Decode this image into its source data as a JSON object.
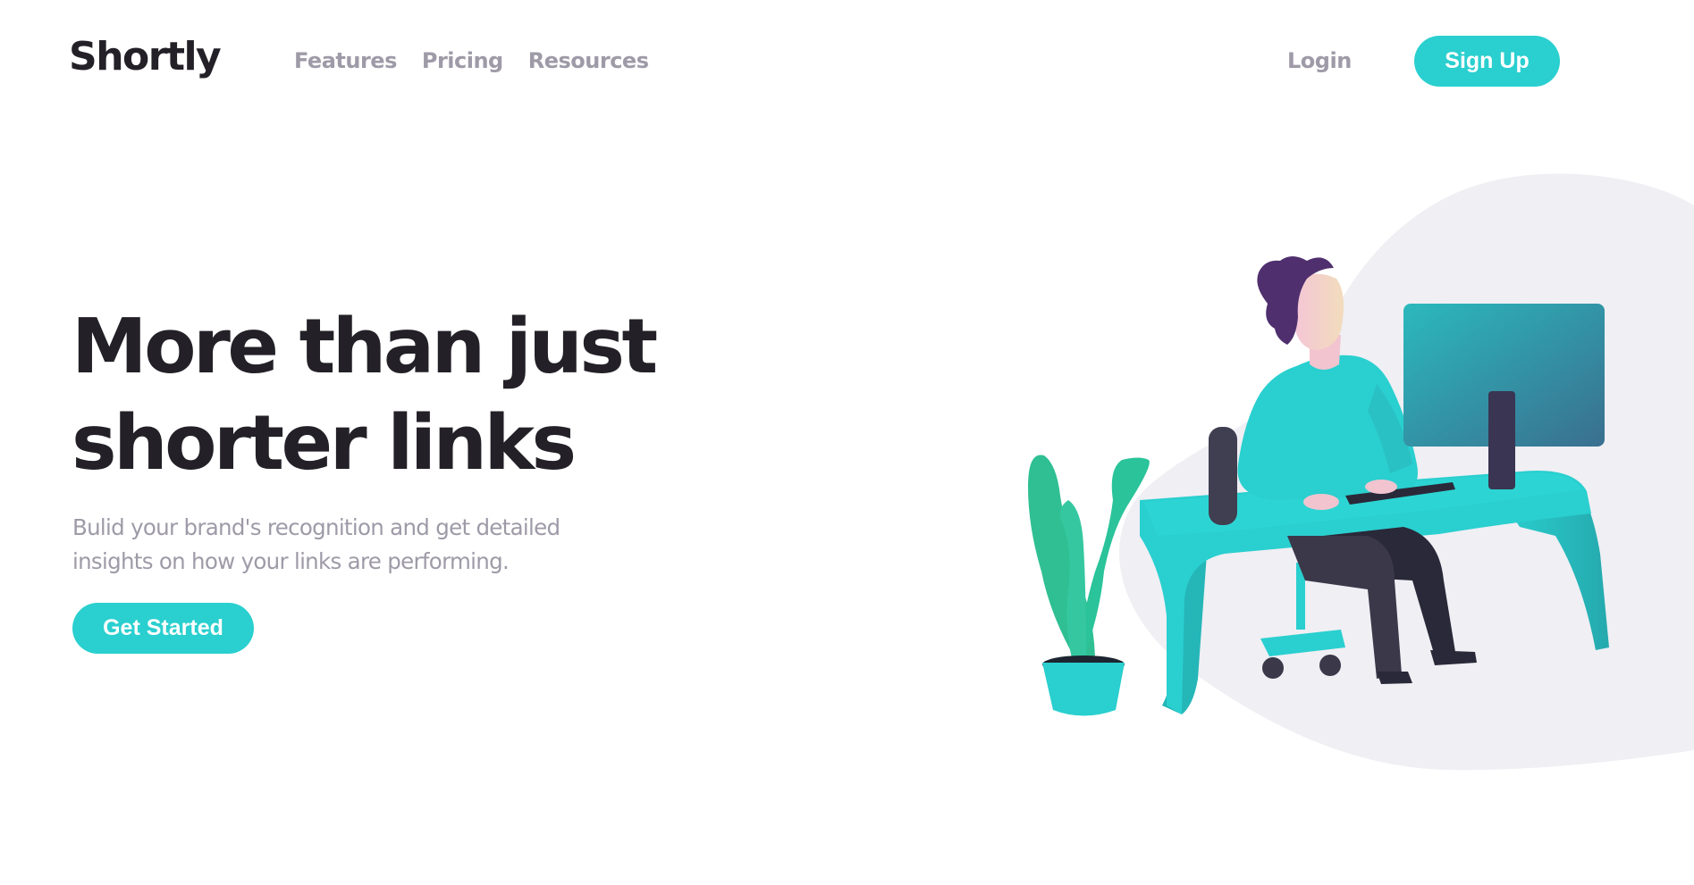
{
  "brand": {
    "logo_text": "Shortly",
    "accent_color": "#2acfcf",
    "dark_color": "#232127",
    "muted_color": "#9e9aa7"
  },
  "nav": {
    "links": [
      {
        "label": "Features"
      },
      {
        "label": "Pricing"
      },
      {
        "label": "Resources"
      }
    ],
    "login_label": "Login",
    "signup_label": "Sign Up"
  },
  "hero": {
    "headline_line1": "More than just",
    "headline_line2": "shorter links",
    "subtext_line1": "Bulid your brand's recognition and get detailed",
    "subtext_line2": "insights on how your links are performing.",
    "cta_label": "Get Started",
    "illustration": "person-working-at-desk-illustration"
  }
}
